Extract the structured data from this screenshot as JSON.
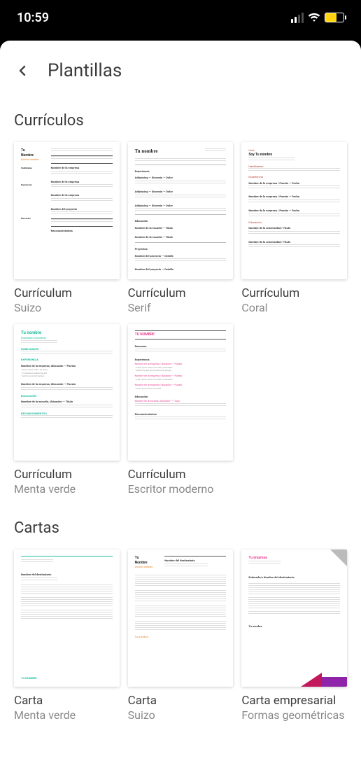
{
  "status": {
    "time": "10:59"
  },
  "header": {
    "title": "Plantillas"
  },
  "sections": [
    {
      "title": "Currículos",
      "templates": [
        {
          "title": "Currículum",
          "subtitle": "Suizo"
        },
        {
          "title": "Currículum",
          "subtitle": "Serif"
        },
        {
          "title": "Currículum",
          "subtitle": "Coral"
        },
        {
          "title": "Currículum",
          "subtitle": "Menta verde"
        },
        {
          "title": "Currículum",
          "subtitle": "Escritor moderno"
        }
      ]
    },
    {
      "title": "Cartas",
      "templates": [
        {
          "title": "Carta",
          "subtitle": "Menta verde"
        },
        {
          "title": "Carta",
          "subtitle": "Suizo"
        },
        {
          "title": "Carta empresarial",
          "subtitle": "Formas geométricas"
        }
      ]
    }
  ],
  "thumb_text": {
    "tu_nombre": "Tu nombre",
    "tu_nombre_caps": "TU NOMBRE",
    "tu": "Tu",
    "nombre": "Nombre"
  }
}
